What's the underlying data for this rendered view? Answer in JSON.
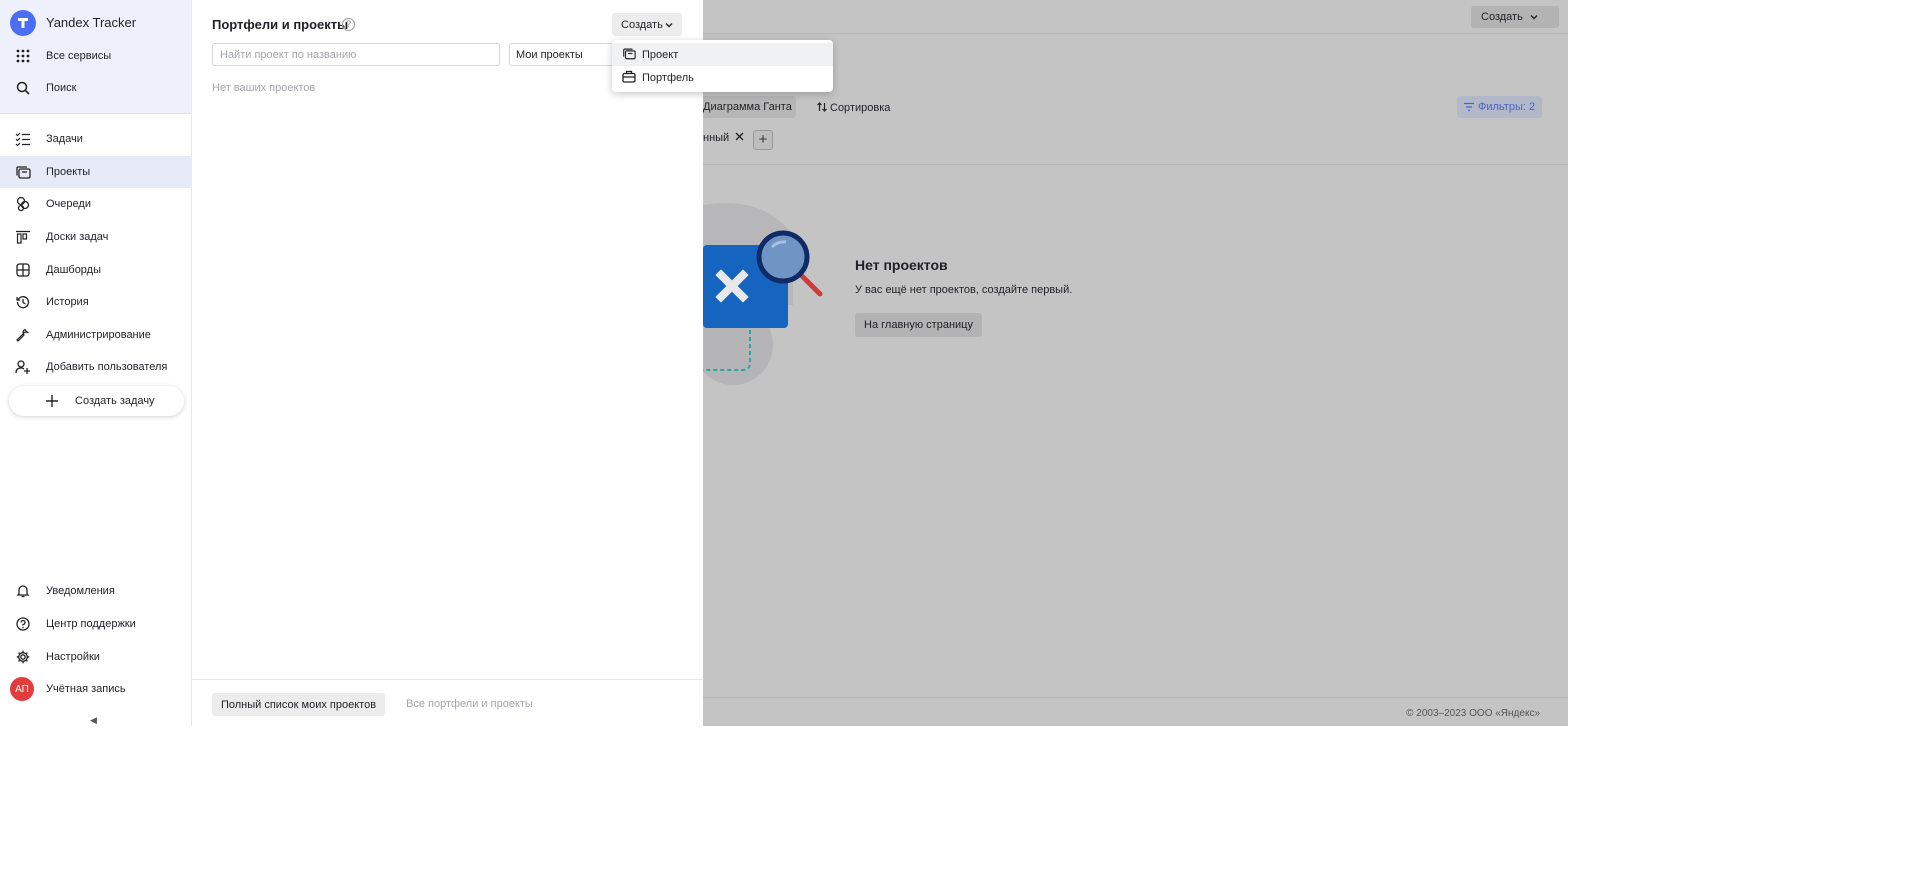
{
  "app": {
    "brand": "Yandex Tracker"
  },
  "sidebar": {
    "top_items": [
      {
        "label": "Все сервисы",
        "icon": "grid-icon"
      },
      {
        "label": "Поиск",
        "icon": "search-icon"
      }
    ],
    "items": [
      {
        "label": "Задачи",
        "icon": "tasks-icon"
      },
      {
        "label": "Проекты",
        "icon": "projects-icon",
        "active": true
      },
      {
        "label": "Очереди",
        "icon": "queues-icon"
      },
      {
        "label": "Доски задач",
        "icon": "boards-icon"
      },
      {
        "label": "Дашборды",
        "icon": "dashboards-icon"
      },
      {
        "label": "История",
        "icon": "history-icon"
      },
      {
        "label": "Администрирование",
        "icon": "wrench-icon"
      },
      {
        "label": "Добавить пользователя",
        "icon": "add-user-icon"
      }
    ],
    "create_task": "Создать задачу",
    "bottom_items": [
      {
        "label": "Уведомления",
        "icon": "bell-icon"
      },
      {
        "label": "Центр поддержки",
        "icon": "help-icon"
      },
      {
        "label": "Настройки",
        "icon": "gear-icon"
      },
      {
        "label": "Учётная запись",
        "icon": "avatar"
      }
    ],
    "avatar_initials": "АП"
  },
  "drawer": {
    "title": "Портфели и проекты",
    "help": "?",
    "create_label": "Создать",
    "search_placeholder": "Найти проект по названию",
    "filter_value": "Мои проекты",
    "empty_text": "Нет ваших проектов",
    "full_list_button": "Полный список моих проектов",
    "all_link": "Все портфели и проекты"
  },
  "create_menu": {
    "items": [
      {
        "label": "Проект",
        "icon": "project-icon",
        "highlighted": true
      },
      {
        "label": "Портфель",
        "icon": "portfolio-icon"
      }
    ]
  },
  "background": {
    "create_label": "Создать",
    "gantt_label": "Диаграмма Ганта",
    "sort_label": "Сортировка",
    "filters_label": "Фильтры: 2",
    "tag_label": "нный",
    "empty_title": "Нет проектов",
    "empty_subtitle": "У вас ещё нет проектов, создайте первый.",
    "home_button": "На главную страницу",
    "copyright": "© 2003–2023 ООО «Яндекс»"
  },
  "colors": {
    "accent": "#4c6ef5",
    "avatar": "#e33c3c",
    "overlay_bg": "#c4c4c4",
    "illustration_blue": "#1565c0",
    "illustration_navy": "#0f2a66",
    "illustration_red": "#d23a3a",
    "illustration_teal": "#2aa79b"
  }
}
